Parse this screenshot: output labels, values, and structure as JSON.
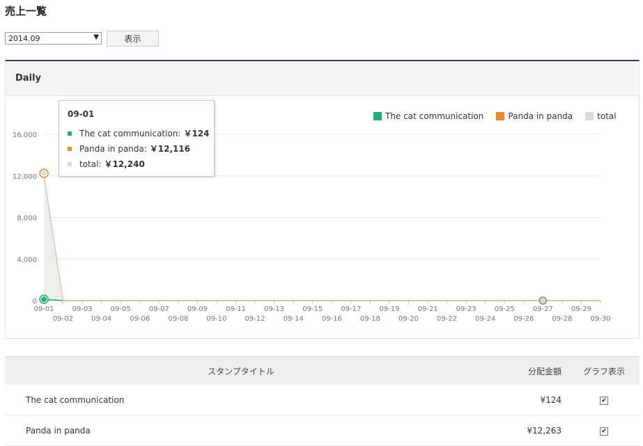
{
  "page": {
    "title": "売上一覧"
  },
  "filter": {
    "month_value": "2014.09",
    "month_arrow": "▼",
    "show_button": "表示"
  },
  "daily": {
    "header": "Daily"
  },
  "colors": {
    "cat": "#1db36b",
    "panda": "#f5892a",
    "total": "#d6dcd6"
  },
  "legend": [
    {
      "label": "The cat communication",
      "color": "#1db36b"
    },
    {
      "label": "Panda in panda",
      "color": "#f5892a"
    },
    {
      "label": "total",
      "color": "#d6dcd6"
    }
  ],
  "tooltip": {
    "date": "09-01",
    "rows": [
      {
        "label": "The cat communication:",
        "value": "￥124",
        "color": "#1db36b"
      },
      {
        "label": "Panda in panda:",
        "value": "￥12,116",
        "color": "#f5892a"
      },
      {
        "label": "total:",
        "value": "￥12,240",
        "color": "#d6dcd6"
      }
    ]
  },
  "chart_data": {
    "type": "area",
    "y_ticks": [
      "0",
      "4,000",
      "8,000",
      "12,000",
      "16,000"
    ],
    "ylim": [
      0,
      16000
    ],
    "grid": true,
    "legend_position": "top-right",
    "categories": [
      "09-01",
      "09-02",
      "09-03",
      "09-04",
      "09-05",
      "09-06",
      "09-07",
      "09-08",
      "09-09",
      "09-10",
      "09-11",
      "09-12",
      "09-13",
      "09-14",
      "09-15",
      "09-16",
      "09-17",
      "09-18",
      "09-19",
      "09-20",
      "09-21",
      "09-22",
      "09-23",
      "09-24",
      "09-25",
      "09-26",
      "09-27",
      "09-28",
      "09-29",
      "09-30"
    ],
    "series": [
      {
        "name": "The cat communication",
        "values": [
          124,
          0,
          0,
          0,
          0,
          0,
          0,
          0,
          0,
          0,
          0,
          0,
          0,
          0,
          0,
          0,
          0,
          0,
          0,
          0,
          0,
          0,
          0,
          0,
          0,
          0,
          0,
          0,
          0,
          0
        ]
      },
      {
        "name": "Panda in panda",
        "values": [
          12116,
          0,
          0,
          0,
          0,
          0,
          0,
          0,
          0,
          0,
          0,
          0,
          0,
          0,
          0,
          0,
          0,
          0,
          0,
          0,
          0,
          0,
          0,
          0,
          0,
          0,
          0,
          0,
          0,
          0
        ]
      },
      {
        "name": "total",
        "values": [
          12240,
          0,
          0,
          0,
          0,
          0,
          0,
          0,
          0,
          0,
          0,
          0,
          0,
          0,
          0,
          0,
          0,
          0,
          0,
          0,
          0,
          0,
          0,
          0,
          0,
          0,
          0,
          0,
          0,
          0
        ]
      }
    ]
  },
  "table": {
    "headers": {
      "title": "スタンプタイトル",
      "amount": "分配金額",
      "graph": "グラフ表示"
    },
    "rows": [
      {
        "title": "The cat communication",
        "amount": "¥124",
        "checked": "✔"
      },
      {
        "title": "Panda in panda",
        "amount": "¥12,263",
        "checked": "✔"
      }
    ]
  }
}
